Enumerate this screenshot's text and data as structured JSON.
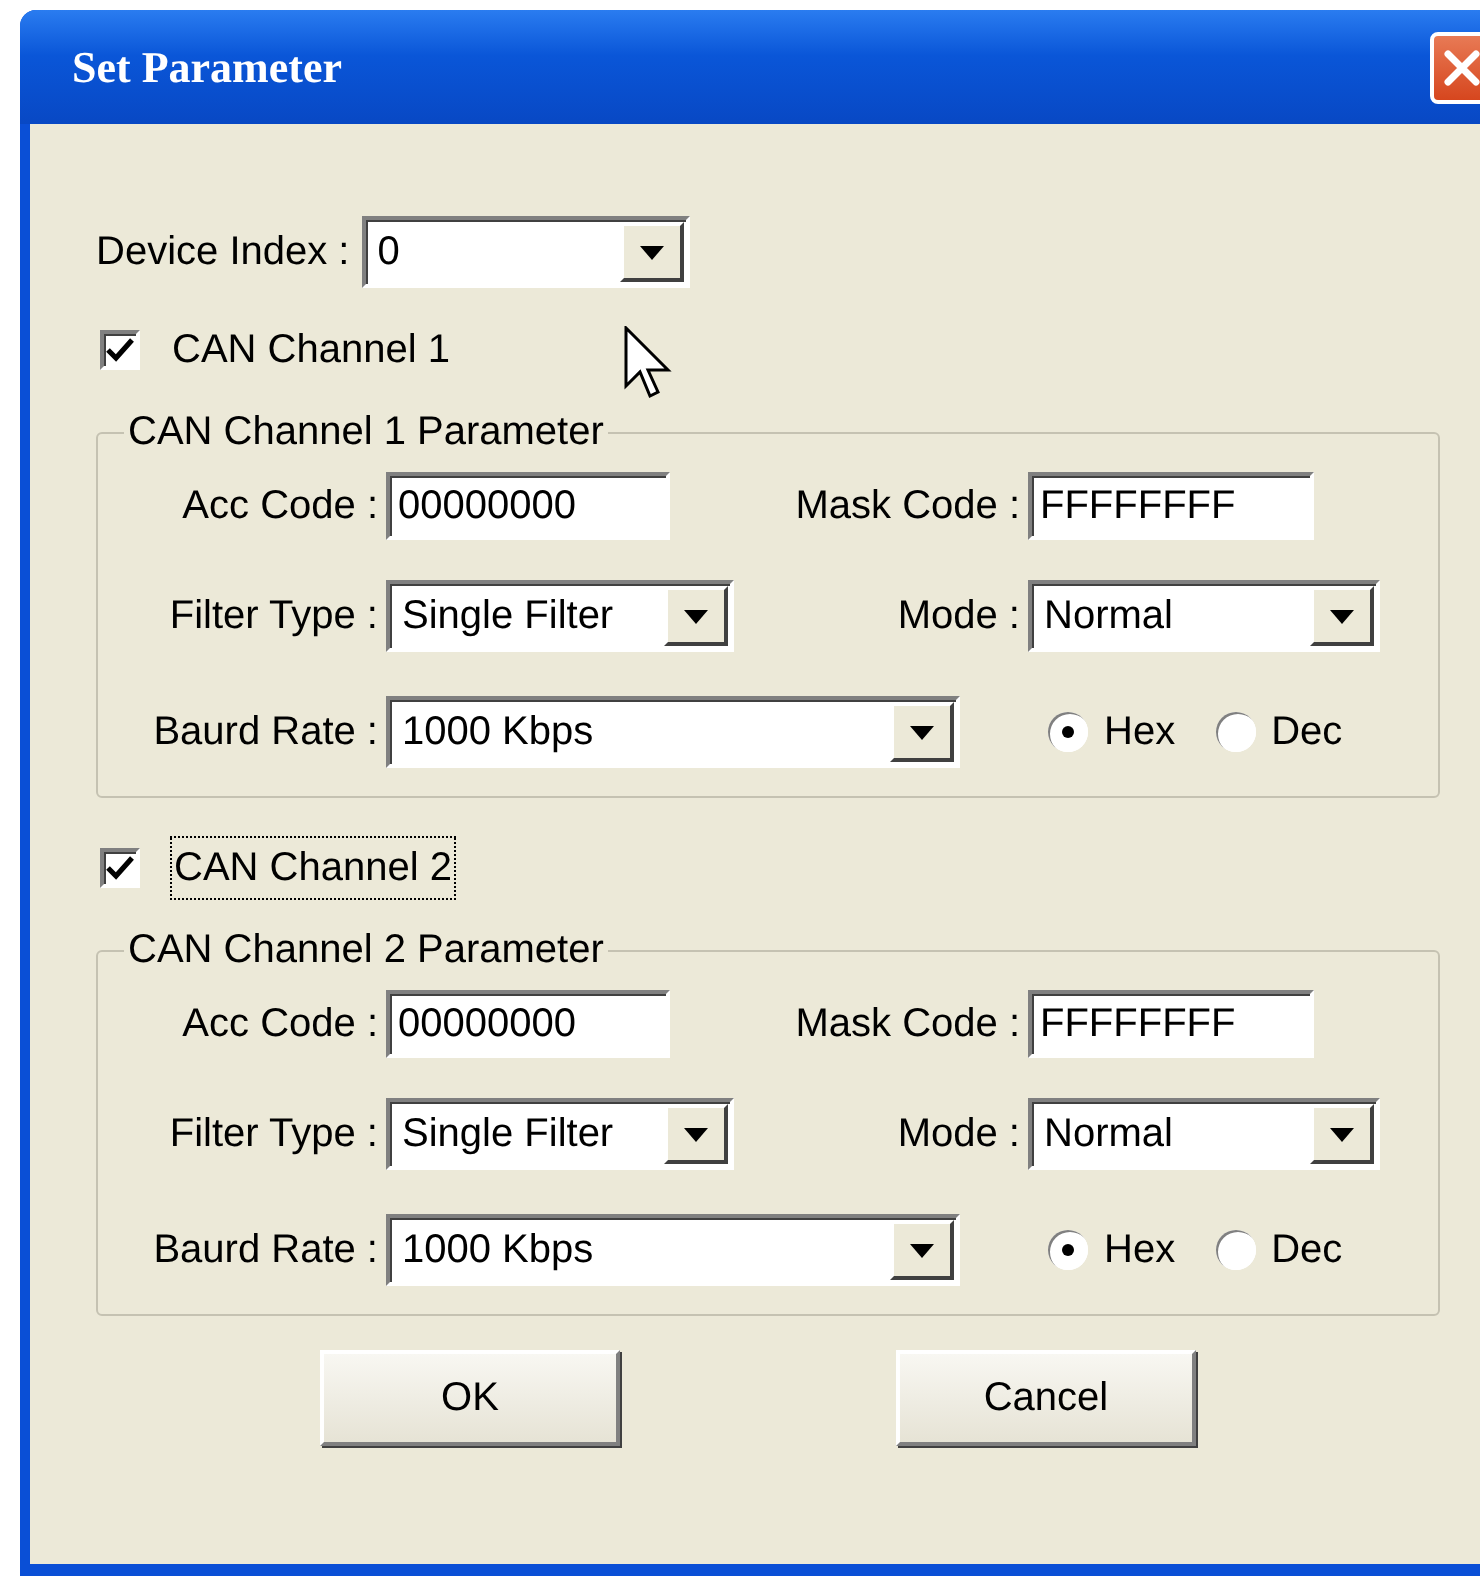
{
  "window": {
    "title": "Set Parameter"
  },
  "device_index": {
    "label": "Device Index :",
    "value": "0"
  },
  "channels": [
    {
      "checkbox_label": "CAN Channel 1",
      "checked": true,
      "focused": false,
      "group_title": "CAN Channel 1 Parameter",
      "acc_code_label": "Acc Code :",
      "acc_code": "00000000",
      "mask_code_label": "Mask Code :",
      "mask_code": "FFFFFFFF",
      "filter_type_label": "Filter Type :",
      "filter_type": "Single Filter",
      "mode_label": "Mode :",
      "mode": "Normal",
      "baud_rate_label": "Baurd Rate :",
      "baud_rate": "1000 Kbps",
      "radios": [
        {
          "label": "Hex",
          "selected": true
        },
        {
          "label": "Dec",
          "selected": false
        }
      ]
    },
    {
      "checkbox_label": "CAN Channel 2",
      "checked": true,
      "focused": true,
      "group_title": "CAN Channel 2 Parameter",
      "acc_code_label": "Acc Code :",
      "acc_code": "00000000",
      "mask_code_label": "Mask Code :",
      "mask_code": "FFFFFFFF",
      "filter_type_label": "Filter Type :",
      "filter_type": "Single Filter",
      "mode_label": "Mode :",
      "mode": "Normal",
      "baud_rate_label": "Baurd Rate :",
      "baud_rate": "1000 Kbps",
      "radios": [
        {
          "label": "Hex",
          "selected": true
        },
        {
          "label": "Dec",
          "selected": false
        }
      ]
    }
  ],
  "buttons": [
    "OK",
    "Cancel"
  ]
}
